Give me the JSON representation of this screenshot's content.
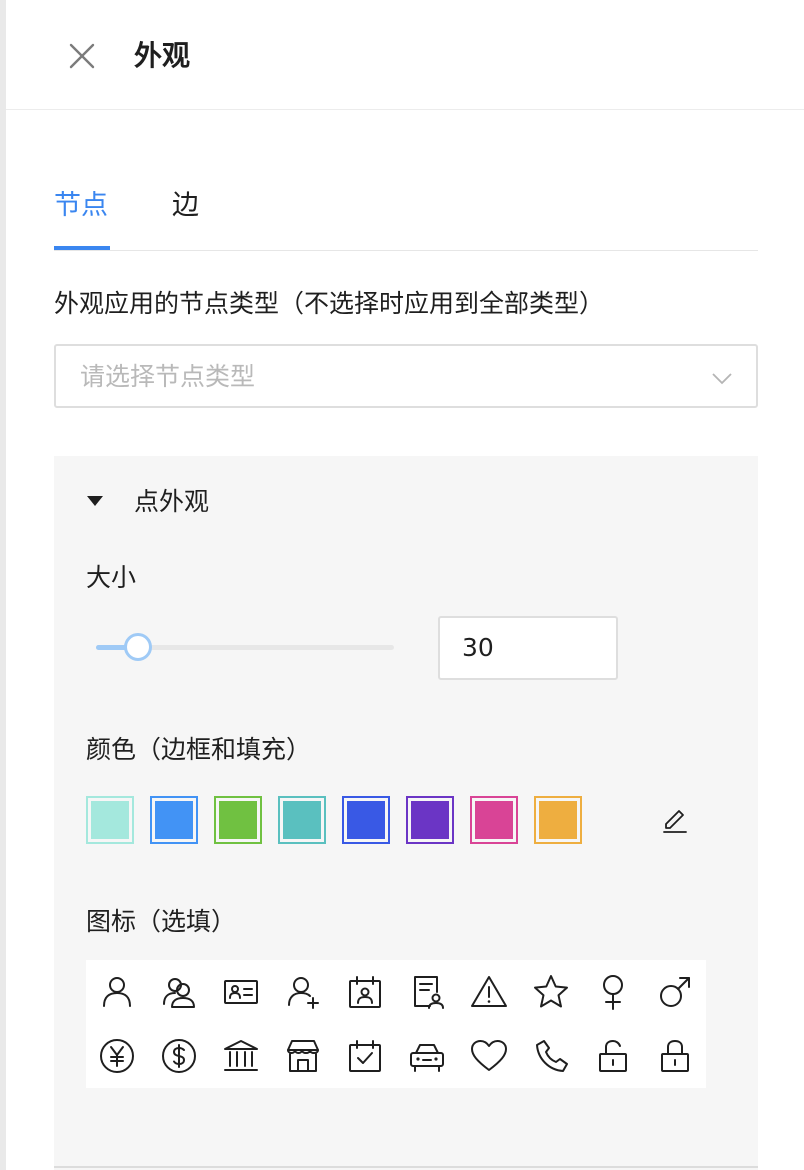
{
  "header": {
    "title": "外观"
  },
  "tabs": [
    {
      "label": "节点",
      "active": true
    },
    {
      "label": "边",
      "active": false
    }
  ],
  "node_type": {
    "label": "外观应用的节点类型（不选择时应用到全部类型）",
    "placeholder": "请选择节点类型"
  },
  "point_appearance": {
    "title": "点外观",
    "size": {
      "label": "大小",
      "value": "30",
      "slider_fraction": 0.14
    },
    "color": {
      "label": "颜色（边框和填充）",
      "swatches": [
        "#a4e8dd",
        "#4293f5",
        "#70c141",
        "#5ac0bf",
        "#3959e5",
        "#6b35c5",
        "#d94496",
        "#eeae40"
      ]
    },
    "icon": {
      "label": "图标（选填）",
      "icons": [
        "user-icon",
        "user-group-icon",
        "id-card-icon",
        "user-add-icon",
        "calendar-user-icon",
        "document-user-icon",
        "warning-icon",
        "star-icon",
        "female-icon",
        "male-icon",
        "yen-coin-icon",
        "dollar-coin-icon",
        "bank-icon",
        "store-icon",
        "calendar-check-icon",
        "car-icon",
        "heart-icon",
        "phone-icon",
        "unlock-icon",
        "lock-icon"
      ]
    }
  },
  "colors": {
    "accent": "#3a86f0",
    "slider": "#9fcaf6"
  }
}
